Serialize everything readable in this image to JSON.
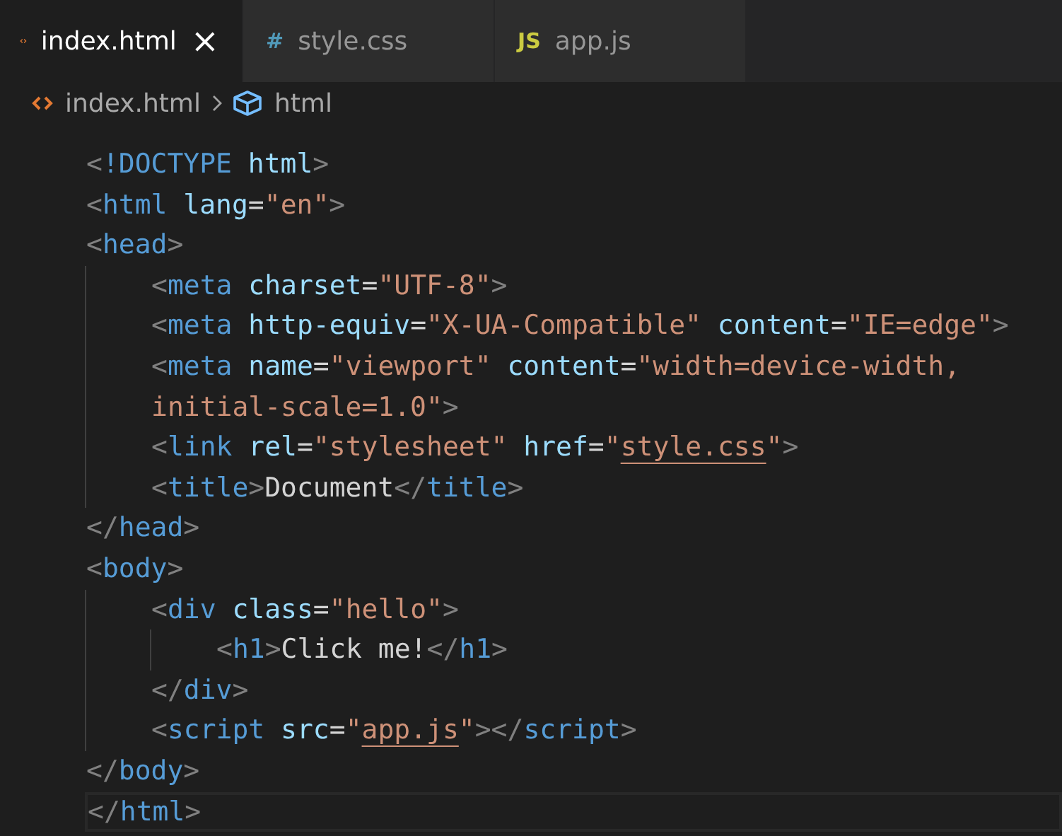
{
  "tabs": [
    {
      "label": "index.html",
      "kind": "html",
      "selected": true,
      "close": "×"
    },
    {
      "label": "style.css",
      "kind": "css",
      "icon_text": "#",
      "selected": false
    },
    {
      "label": "app.js",
      "kind": "js",
      "icon_text": "JS",
      "selected": false
    }
  ],
  "breadcrumb": [
    {
      "label": "index.html",
      "kind": "file"
    },
    {
      "label": "html",
      "kind": "element"
    }
  ],
  "code": [
    {
      "current": false,
      "tokens": [
        {
          "kind": "punct",
          "text": "<"
        },
        {
          "kind": "tag",
          "text": "!DOCTYPE"
        },
        {
          "kind": "attr",
          "text": " html"
        },
        {
          "kind": "punct",
          "text": ">"
        }
      ]
    },
    {
      "current": false,
      "tokens": [
        {
          "kind": "punct",
          "text": "<"
        },
        {
          "kind": "tag",
          "text": "html"
        },
        {
          "kind": "attr",
          "text": " lang"
        },
        {
          "kind": "text",
          "text": "="
        },
        {
          "kind": "string",
          "text": "\"en\""
        },
        {
          "kind": "punct",
          "text": ">"
        }
      ]
    },
    {
      "current": false,
      "tokens": [
        {
          "kind": "punct",
          "text": "<"
        },
        {
          "kind": "tag",
          "text": "head"
        },
        {
          "kind": "punct",
          "text": ">"
        }
      ],
      "children": [
        {
          "current": false,
          "tokens": [
            {
              "kind": "punct",
              "text": "<"
            },
            {
              "kind": "tag",
              "text": "meta"
            },
            {
              "kind": "attr",
              "text": " charset"
            },
            {
              "kind": "text",
              "text": "="
            },
            {
              "kind": "string",
              "text": "\"UTF-8\""
            },
            {
              "kind": "punct",
              "text": ">"
            }
          ]
        },
        {
          "current": false,
          "tokens": [
            {
              "kind": "punct",
              "text": "<"
            },
            {
              "kind": "tag",
              "text": "meta"
            },
            {
              "kind": "attr",
              "text": " http-equiv"
            },
            {
              "kind": "text",
              "text": "="
            },
            {
              "kind": "string",
              "text": "\"X-UA-Compatible\""
            },
            {
              "kind": "attr",
              "text": " content"
            },
            {
              "kind": "text",
              "text": "="
            },
            {
              "kind": "string",
              "text": "\"IE=edge\""
            },
            {
              "kind": "punct",
              "text": ">"
            }
          ]
        },
        {
          "current": false,
          "tokens": [
            {
              "kind": "punct",
              "text": "<"
            },
            {
              "kind": "tag",
              "text": "meta"
            },
            {
              "kind": "attr",
              "text": " name"
            },
            {
              "kind": "text",
              "text": "="
            },
            {
              "kind": "string",
              "text": "\"viewport\""
            },
            {
              "kind": "attr",
              "text": " content"
            },
            {
              "kind": "text",
              "text": "="
            },
            {
              "kind": "string",
              "text": "\"width=device-width,"
            }
          ]
        },
        {
          "current": false,
          "tokens": [
            {
              "kind": "string",
              "text": "initial-scale=1.0\""
            },
            {
              "kind": "punct",
              "text": ">"
            }
          ]
        },
        {
          "current": false,
          "tokens": [
            {
              "kind": "punct",
              "text": "<"
            },
            {
              "kind": "tag",
              "text": "link"
            },
            {
              "kind": "attr",
              "text": " rel"
            },
            {
              "kind": "text",
              "text": "="
            },
            {
              "kind": "string",
              "text": "\"stylesheet\""
            },
            {
              "kind": "attr",
              "text": " href"
            },
            {
              "kind": "text",
              "text": "="
            },
            {
              "kind": "string",
              "text": "\""
            },
            {
              "kind": "link",
              "text": "style.css"
            },
            {
              "kind": "string",
              "text": "\""
            },
            {
              "kind": "punct",
              "text": ">"
            }
          ]
        },
        {
          "current": false,
          "tokens": [
            {
              "kind": "punct",
              "text": "<"
            },
            {
              "kind": "tag",
              "text": "title"
            },
            {
              "kind": "punct",
              "text": ">"
            },
            {
              "kind": "text",
              "text": "Document"
            },
            {
              "kind": "punct",
              "text": "</"
            },
            {
              "kind": "tag",
              "text": "title"
            },
            {
              "kind": "punct",
              "text": ">"
            }
          ]
        }
      ]
    },
    {
      "current": false,
      "tokens": [
        {
          "kind": "punct",
          "text": "</"
        },
        {
          "kind": "tag",
          "text": "head"
        },
        {
          "kind": "punct",
          "text": ">"
        }
      ]
    },
    {
      "current": false,
      "tokens": [
        {
          "kind": "punct",
          "text": "<"
        },
        {
          "kind": "tag",
          "text": "body"
        },
        {
          "kind": "punct",
          "text": ">"
        }
      ],
      "children": [
        {
          "current": false,
          "tokens": [
            {
              "kind": "punct",
              "text": "<"
            },
            {
              "kind": "tag",
              "text": "div"
            },
            {
              "kind": "attr",
              "text": " class"
            },
            {
              "kind": "text",
              "text": "="
            },
            {
              "kind": "string",
              "text": "\"hello\""
            },
            {
              "kind": "punct",
              "text": ">"
            }
          ],
          "children": [
            {
              "current": false,
              "tokens": [
                {
                  "kind": "punct",
                  "text": "<"
                },
                {
                  "kind": "tag",
                  "text": "h1"
                },
                {
                  "kind": "punct",
                  "text": ">"
                },
                {
                  "kind": "text",
                  "text": "Click me!"
                },
                {
                  "kind": "punct",
                  "text": "</"
                },
                {
                  "kind": "tag",
                  "text": "h1"
                },
                {
                  "kind": "punct",
                  "text": ">"
                }
              ]
            }
          ]
        },
        {
          "current": false,
          "tokens": [
            {
              "kind": "punct",
              "text": "</"
            },
            {
              "kind": "tag",
              "text": "div"
            },
            {
              "kind": "punct",
              "text": ">"
            }
          ]
        },
        {
          "current": false,
          "tokens": [
            {
              "kind": "punct",
              "text": "<"
            },
            {
              "kind": "tag",
              "text": "script"
            },
            {
              "kind": "attr",
              "text": " src"
            },
            {
              "kind": "text",
              "text": "="
            },
            {
              "kind": "string",
              "text": "\""
            },
            {
              "kind": "link",
              "text": "app.js"
            },
            {
              "kind": "string",
              "text": "\""
            },
            {
              "kind": "punct",
              "text": "></"
            },
            {
              "kind": "tag",
              "text": "script"
            },
            {
              "kind": "punct",
              "text": ">"
            }
          ]
        }
      ]
    },
    {
      "current": false,
      "tokens": [
        {
          "kind": "punct",
          "text": "</"
        },
        {
          "kind": "tag",
          "text": "body"
        },
        {
          "kind": "punct",
          "text": ">"
        }
      ]
    },
    {
      "current": true,
      "tokens": [
        {
          "kind": "punct",
          "text": "</"
        },
        {
          "kind": "tag",
          "text": "html"
        },
        {
          "kind": "punct",
          "text": ">"
        }
      ]
    }
  ]
}
